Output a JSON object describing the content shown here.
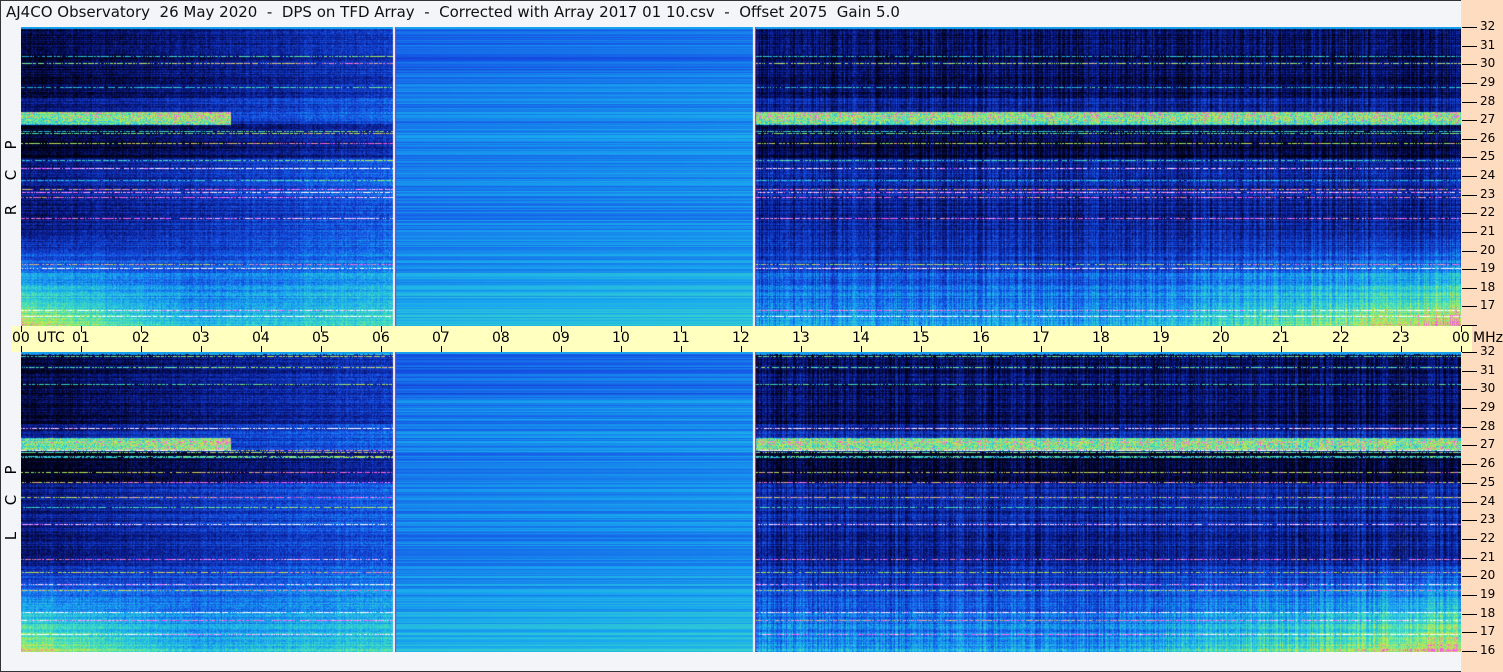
{
  "title": "AJ4CO Observatory  26 May 2020  -  DPS on TFD Array  -  Corrected with Array 2017 01 10.csv  -  Offset 2075  Gain 5.0",
  "chart_data": {
    "type": "heatmap",
    "title": "AJ4CO Observatory  26 May 2020  -  DPS on TFD Array  -  Corrected with Array 2017 01 10.csv  -  Offset 2075  Gain 5.0",
    "xlabel": "UTC",
    "ylabel": "MHz",
    "xlim": [
      0,
      24
    ],
    "ylim": [
      16,
      32
    ],
    "x_ticks": [
      "00",
      "01",
      "02",
      "03",
      "04",
      "05",
      "06",
      "07",
      "08",
      "09",
      "10",
      "11",
      "12",
      "13",
      "14",
      "15",
      "16",
      "17",
      "18",
      "19",
      "20",
      "21",
      "22",
      "23",
      "00"
    ],
    "x_unit_label": "UTC",
    "y_unit_label": "MHz",
    "y_ticks": [
      "32",
      "31",
      "30",
      "29",
      "28",
      "27",
      "26",
      "25",
      "24",
      "23",
      "22",
      "21",
      "20",
      "19",
      "18",
      "17",
      "16"
    ],
    "panels": [
      {
        "name": "RCP",
        "label_letters": [
          "R",
          "C",
          "P"
        ]
      },
      {
        "name": "LCP",
        "label_letters": [
          "L",
          "C",
          "P"
        ]
      }
    ],
    "markers_utc": [
      6.2,
      12.2
    ],
    "colormap": [
      "#000010",
      "#0a1a8c",
      "#1550e6",
      "#18a8f0",
      "#40e0c0",
      "#c8f040",
      "#ff40ff",
      "#ffffff"
    ]
  }
}
